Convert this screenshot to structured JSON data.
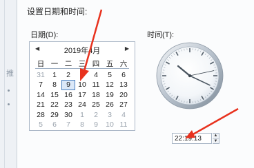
{
  "left_strip": {
    "glyph": "推"
  },
  "dialog": {
    "title": "设置日期和时间:",
    "date_label": "日期(D):",
    "time_label": "时间(T):"
  },
  "calendar": {
    "prev_icon": "◀",
    "next_icon": "▶",
    "month_title": "2019年4月",
    "weekdays": [
      "日",
      "一",
      "二",
      "三",
      "四",
      "五",
      "六"
    ],
    "weeks": [
      [
        {
          "d": "31",
          "o": true
        },
        {
          "d": "1"
        },
        {
          "d": "2"
        },
        {
          "d": "3"
        },
        {
          "d": "4"
        },
        {
          "d": "5"
        },
        {
          "d": "6"
        }
      ],
      [
        {
          "d": "7"
        },
        {
          "d": "8"
        },
        {
          "d": "9",
          "sel": true
        },
        {
          "d": "10"
        },
        {
          "d": "11"
        },
        {
          "d": "12"
        },
        {
          "d": "13"
        }
      ],
      [
        {
          "d": "14"
        },
        {
          "d": "15"
        },
        {
          "d": "16"
        },
        {
          "d": "17"
        },
        {
          "d": "18"
        },
        {
          "d": "19"
        },
        {
          "d": "20"
        }
      ],
      [
        {
          "d": "21"
        },
        {
          "d": "22"
        },
        {
          "d": "23"
        },
        {
          "d": "24"
        },
        {
          "d": "25"
        },
        {
          "d": "26"
        },
        {
          "d": "27"
        }
      ],
      [
        {
          "d": "28"
        },
        {
          "d": "29"
        },
        {
          "d": "30"
        },
        {
          "d": "1",
          "o": true
        },
        {
          "d": "2",
          "o": true
        },
        {
          "d": "3",
          "o": true
        },
        {
          "d": "4",
          "o": true
        }
      ],
      [
        {
          "d": "5",
          "o": true
        },
        {
          "d": "6",
          "o": true
        },
        {
          "d": "7",
          "o": true
        },
        {
          "d": "8",
          "o": true
        },
        {
          "d": "9",
          "o": true
        },
        {
          "d": "10",
          "o": true
        },
        {
          "d": "11",
          "o": true
        }
      ]
    ]
  },
  "clock": {
    "hour": 22,
    "minute": 19,
    "second": 13
  },
  "time_field": {
    "value": "22:19:13",
    "up_icon": "▲",
    "down_icon": "▼"
  },
  "annotation_color": "#e8321e"
}
